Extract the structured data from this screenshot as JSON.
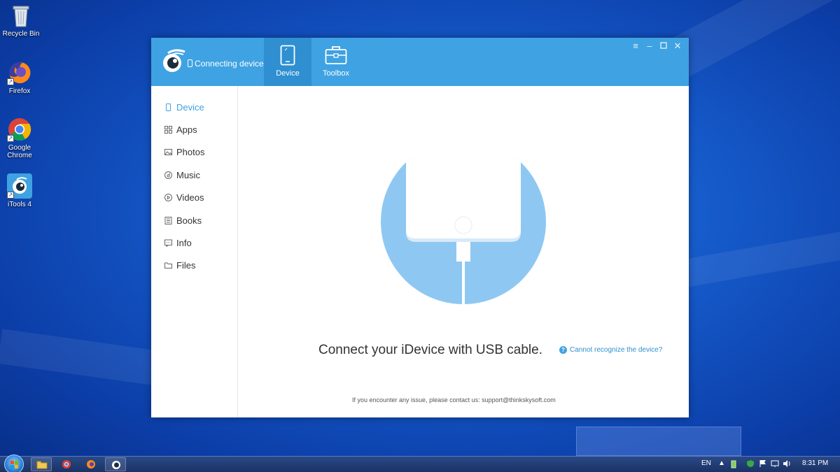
{
  "desktop": {
    "icons": [
      {
        "label": "Recycle Bin",
        "icon": "recycle-bin-icon"
      },
      {
        "label": "Firefox",
        "icon": "firefox-icon"
      },
      {
        "label": "Google Chrome",
        "icon": "chrome-icon"
      },
      {
        "label": "iTools 4",
        "icon": "itools-icon"
      }
    ]
  },
  "app": {
    "status": "Connecting device...",
    "nav": [
      {
        "label": "Device",
        "icon": "tablet-icon",
        "active": true
      },
      {
        "label": "Toolbox",
        "icon": "toolbox-icon",
        "active": false
      }
    ],
    "window_controls": [
      "menu-icon",
      "minimize-icon",
      "maximize-icon",
      "close-icon"
    ],
    "sidebar": [
      {
        "label": "Device",
        "icon": "phone-icon",
        "active": true
      },
      {
        "label": "Apps",
        "icon": "apps-grid-icon"
      },
      {
        "label": "Photos",
        "icon": "photo-icon"
      },
      {
        "label": "Music",
        "icon": "music-icon"
      },
      {
        "label": "Videos",
        "icon": "video-icon"
      },
      {
        "label": "Books",
        "icon": "book-icon"
      },
      {
        "label": "Info",
        "icon": "info-message-icon"
      },
      {
        "label": "Files",
        "icon": "folder-icon"
      }
    ],
    "main": {
      "connect_message": "Connect your iDevice with USB cable.",
      "help_link": "Cannot recognize the device?",
      "footer_note": "If you encounter any issue, please contact us: support@thinkskysoft.com"
    },
    "accent_color": "#3fa2e2"
  },
  "taskbar": {
    "language": "EN",
    "time": "8:31 PM"
  }
}
